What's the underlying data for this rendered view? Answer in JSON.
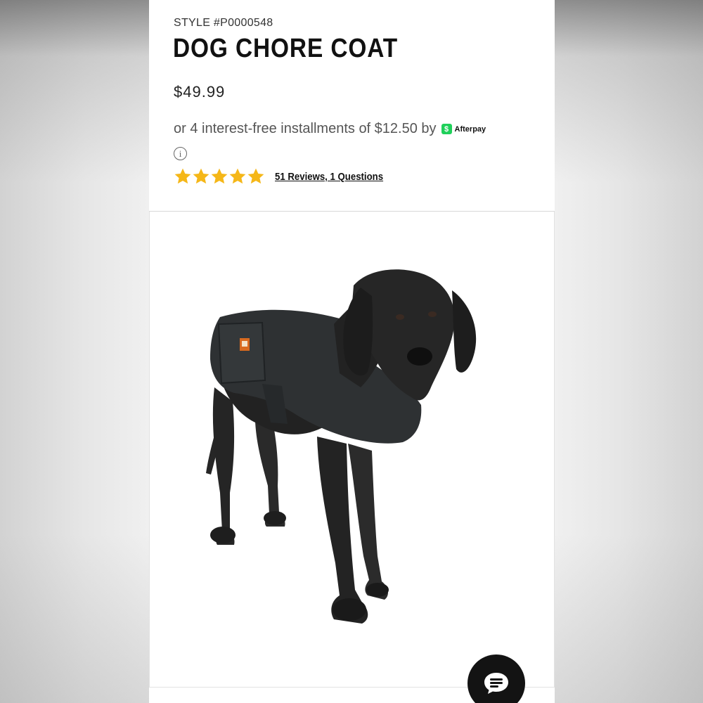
{
  "product": {
    "style_number": "STYLE #P0000548",
    "title": "DOG CHORE COAT",
    "price": "$49.99",
    "installments_text": "or 4 interest-free installments of $12.50 by",
    "afterpay_label": "Afterpay",
    "afterpay_icon": "afterpay-logo-icon",
    "rating": {
      "stars_filled": 5,
      "stars_total": 5,
      "star_color": "#f5b718",
      "reviews_link": "51 Reviews, 1 Questions"
    },
    "image": {
      "subject": "dog-wearing-chore-coat",
      "label_color": "#d86a1f"
    }
  },
  "chat": {
    "icon": "chat-bubble-icon"
  },
  "colors": {
    "text_primary": "#111111",
    "afterpay_green": "#1fd05a",
    "chat_button": "#131313"
  }
}
